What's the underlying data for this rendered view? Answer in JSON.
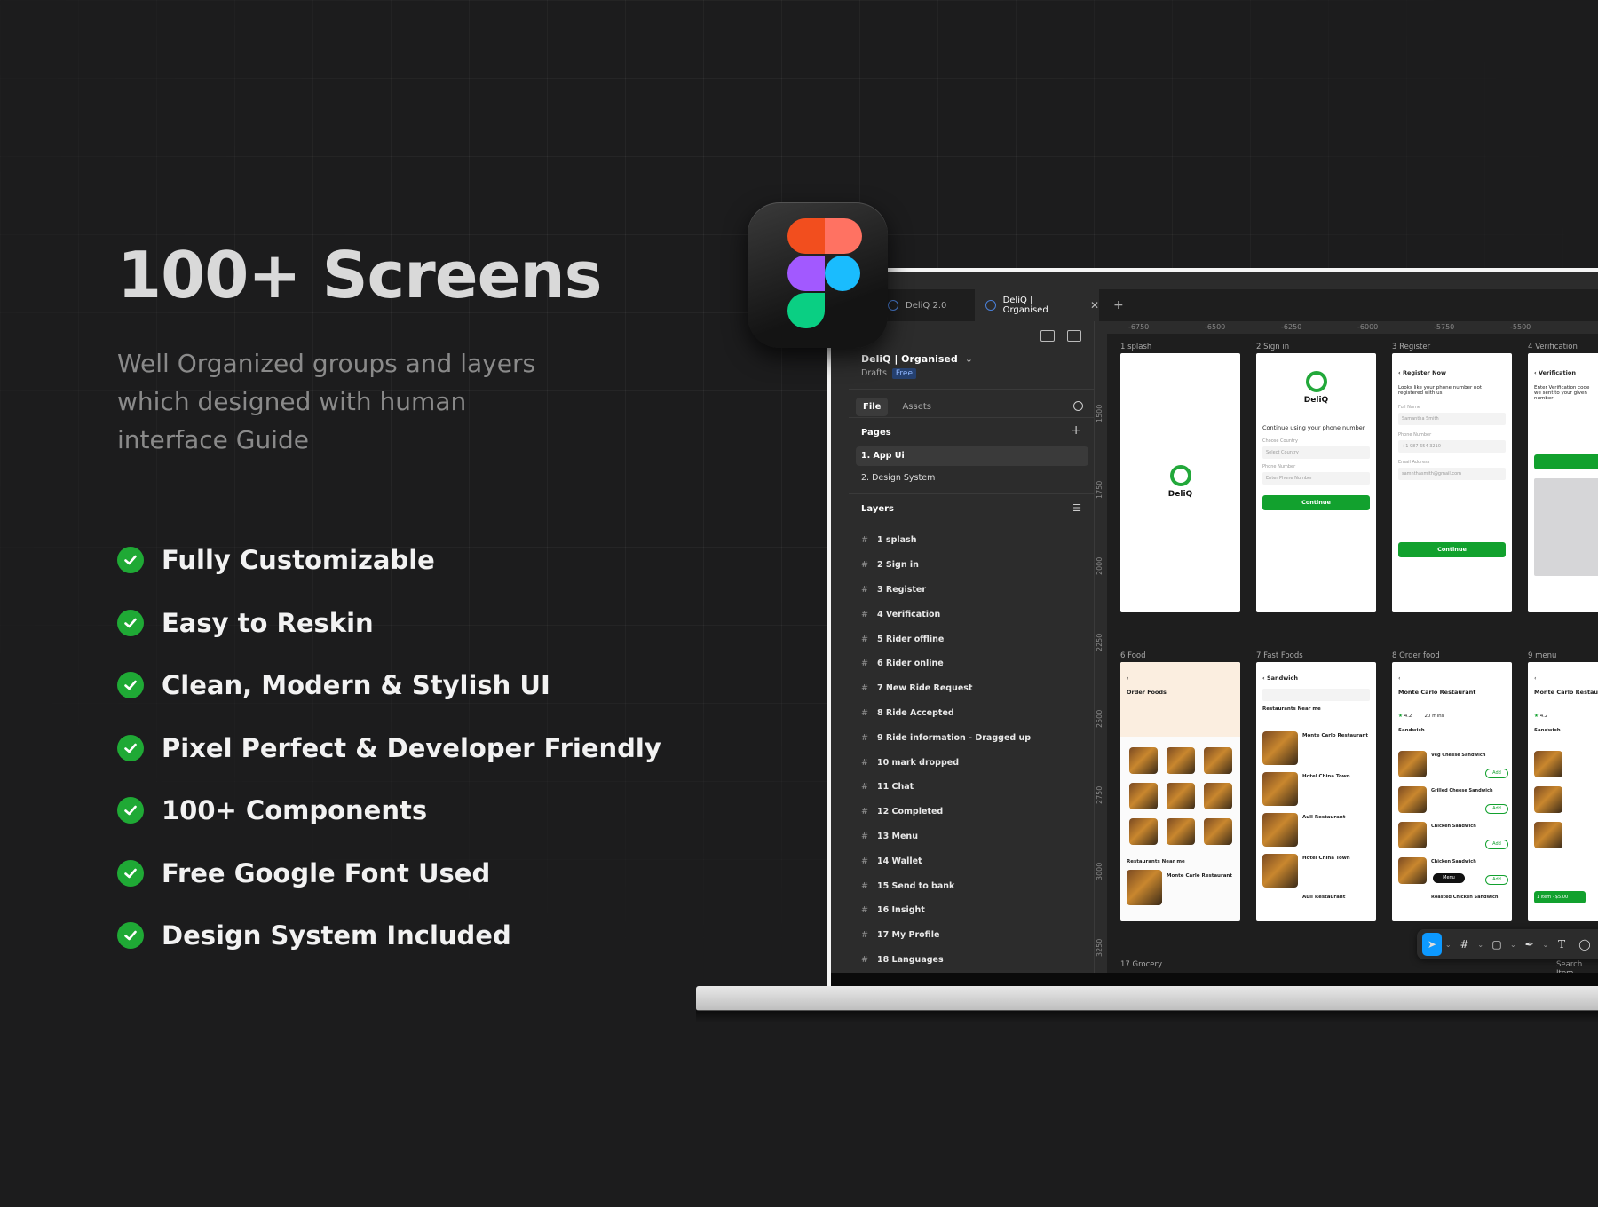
{
  "hero": {
    "title": "100+ Screens",
    "subtitle": "Well Organized groups and layers which designed with human interface Guide"
  },
  "features": [
    "Fully Customizable",
    "Easy to Reskin",
    "Clean, Modern & Stylish UI",
    "Pixel Perfect & Developer Friendly",
    "100+ Components",
    "Free Google Font Used",
    "Design System Included"
  ],
  "colors": {
    "check": "#1fa935",
    "accent": "#0d99ff",
    "brand_green": "#12a12e"
  },
  "figma": {
    "tabs": [
      {
        "label": "DeliQ 2.0"
      },
      {
        "label": "DeliQ | Organised",
        "active": true
      }
    ],
    "project": {
      "name": "DeliQ | Organised",
      "drafts": "Drafts",
      "badge": "Free"
    },
    "file_tabs": [
      "File",
      "Assets"
    ],
    "pages_title": "Pages",
    "pages": [
      "1. App Ui",
      "2. Design System"
    ],
    "layers_title": "Layers",
    "layers": [
      "1 splash",
      "2 Sign in",
      "3 Register",
      "4 Verification",
      "5 Rider offline",
      "6 Rider online",
      "7 New Ride Request",
      "8 Ride Accepted",
      "9 Ride information - Dragged up",
      "10 mark dropped",
      "11 Chat",
      "12 Completed",
      "13 Menu",
      "14 Wallet",
      "15 Send to bank",
      "16 Insight",
      "17 My Profile",
      "18 Languages"
    ],
    "ruler_top": [
      "-6750",
      "-6500",
      "-6250",
      "-6000",
      "-5750",
      "-5500"
    ],
    "ruler_left": [
      "1500",
      "1750",
      "2000",
      "2250",
      "2500",
      "2750",
      "3000",
      "3250"
    ],
    "frames_row1": [
      "1 splash",
      "2 Sign in",
      "3 Register",
      "4 Verification"
    ],
    "frames_row2": [
      "6 Food",
      "7 Fast Foods",
      "8 Order food",
      "9 menu"
    ],
    "frames_row3": [
      "17 Grocery",
      "Search Item"
    ],
    "app": {
      "brand": "DeliQ",
      "signin_text": "Continue using your phone number",
      "choose_country": "Choose Country",
      "select_country": "Select Country",
      "phone_number": "Phone Number",
      "enter_phone": "Enter Phone Number",
      "continue": "Continue",
      "register_title": "Register Now",
      "register_text": "Looks like your phone number not registered with us",
      "full_name": "Full Name",
      "name_value": "Samantha Smith",
      "phone_value": "+1 987 654 3210",
      "email_label": "Email Address",
      "email_value": "samnthasmith@gmail.com",
      "verification": "Verification",
      "enter_verif": "Enter Verification code we sent to your given number",
      "order_foods": "Order Foods",
      "sandwich": "Sandwich",
      "restaurants_near": "Restaurants Near me",
      "restaurant": "Monte Carlo Restaurant",
      "hotel": "Hotel China Town",
      "aull": "Aull Restaurant",
      "veg_cheese": "Veg Cheese Sandwich",
      "grilled": "Grilled Cheese Sandwich",
      "chicken": "Chicken Sandwich",
      "roasted": "Roasted Chicken Sandwich",
      "add": "Add",
      "menu": "Menu",
      "rating": "4.2",
      "time": "20 mins",
      "item_bar": "1 item · $5.00"
    }
  }
}
